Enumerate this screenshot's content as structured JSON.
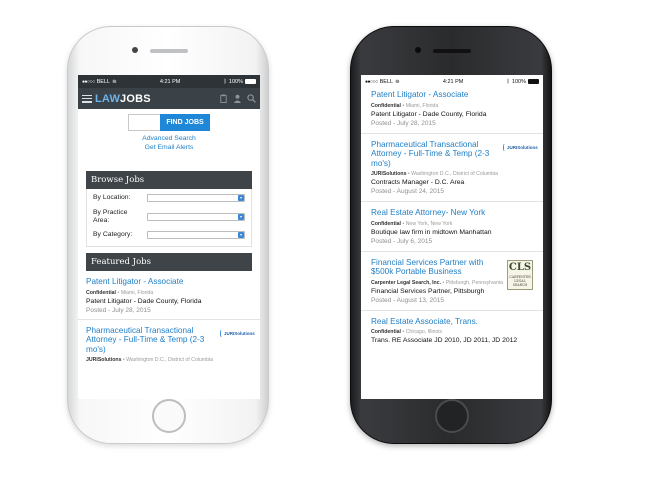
{
  "status": {
    "carrier": "BELL",
    "time": "4:21 PM",
    "battery": "100%"
  },
  "header": {
    "logo_law": "LAW",
    "logo_jobs": "JOBS"
  },
  "search": {
    "button_label": "FIND JOBS",
    "advanced_link": "Advanced Search",
    "alerts_link": "Get Email Alerts"
  },
  "browse": {
    "title": "Browse Jobs",
    "filters": [
      {
        "label": "By Location:"
      },
      {
        "label": "By Practice Area:"
      },
      {
        "label": "By Category:"
      }
    ]
  },
  "featured": {
    "title": "Featured Jobs"
  },
  "left_jobs": [
    {
      "title": "Patent Litigator - Associate",
      "company": "Confidential",
      "location": "Miami, Florida",
      "subtitle": "Patent Litigator - Dade County, Florida",
      "posted": "Posted - July 28, 2015"
    },
    {
      "title": "Pharmaceutical Transactional Attorney - Full-Time & Temp (2-3 mo's)",
      "company": "JURISolutions",
      "location": "Washington D.C., District of Columbia",
      "logo": "JURISolutions"
    }
  ],
  "right_jobs": [
    {
      "title": "Patent Litigator - Associate",
      "company": "Confidential",
      "location": "Miami, Florida",
      "subtitle": "Patent Litigator - Dade County, Florida",
      "posted": "Posted - July 28, 2015"
    },
    {
      "title": "Pharmaceutical Transactional Attorney - Full-Time & Temp (2-3 mo's)",
      "company": "JURISolutions",
      "location": "Washington D.C., District of Columbia",
      "subtitle": "Contracts Manager - D.C. Area",
      "posted": "Posted - August 24, 2015",
      "logo": "JURISolutions"
    },
    {
      "title": "Real Estate Attorney- New York",
      "company": "Confidential",
      "location": "New York, New York",
      "subtitle": "Boutique law firm in midtown Manhattan",
      "posted": "Posted - July 6, 2015"
    },
    {
      "title": "Financial Services Partner with $500k Portable Business",
      "company": "Carpenter Legal Search, Inc.",
      "location": "Pittsburgh, Pennsylvania",
      "subtitle": "Financial Services Partner, Pittsburgh",
      "posted": "Posted - August 13, 2015",
      "logo_big": "CLS",
      "logo_small": "CARPENTER LEGAL SEARCH"
    },
    {
      "title": "Real Estate Associate, Trans.",
      "company": "Confidential",
      "location": "Chicago, Illinois",
      "subtitle": "Trans. RE Associate JD 2010, JD 2011, JD 2012"
    }
  ],
  "colors": {
    "header_bg": "#3a4147",
    "link_blue": "#1f7fc8",
    "button_blue": "#1f87d8",
    "section_bar": "#3f4448"
  }
}
